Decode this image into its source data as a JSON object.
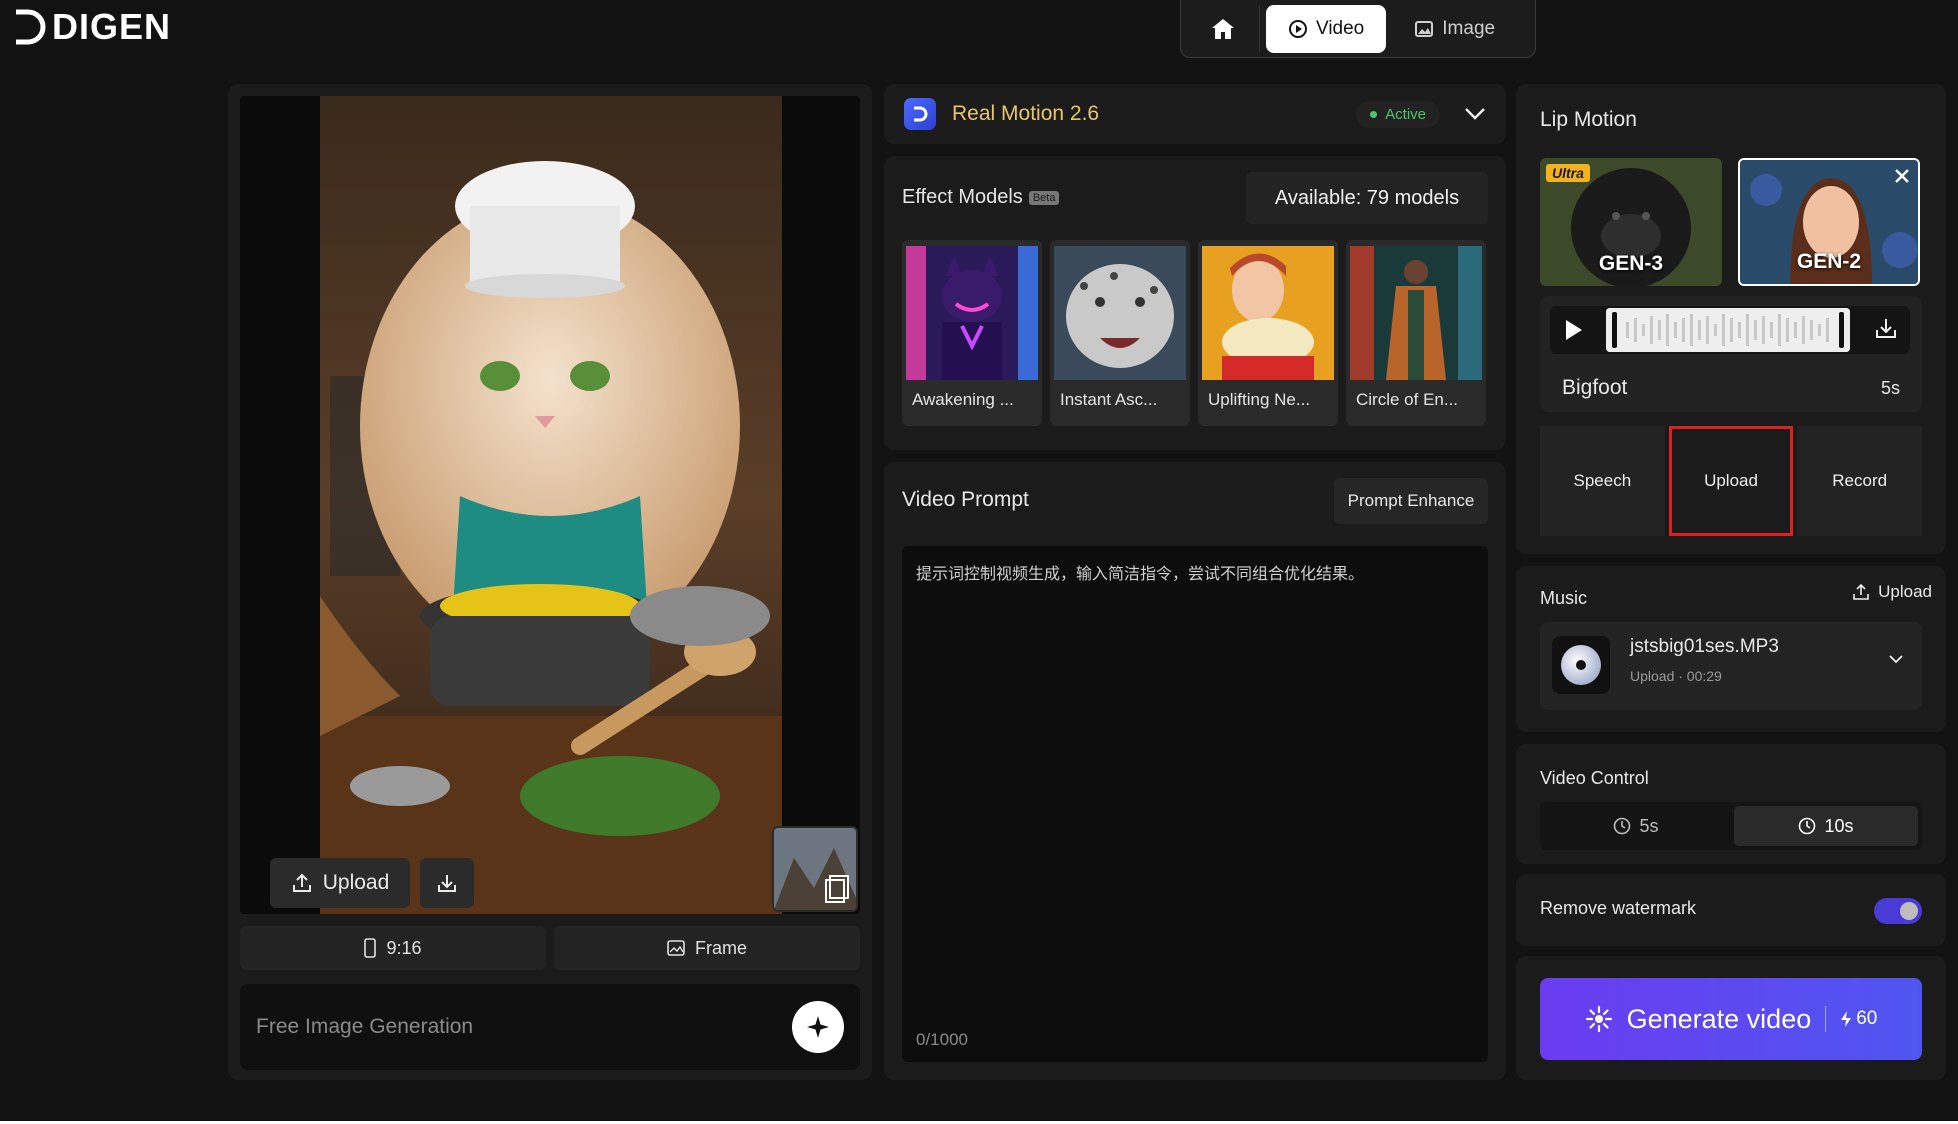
{
  "brand": {
    "name": "DIGEN"
  },
  "topnav": {
    "tabs": [
      {
        "label": "Video"
      },
      {
        "label": "Image"
      }
    ]
  },
  "left": {
    "upload_label": "Upload",
    "ratio_label": "9:16",
    "frame_label": "Frame",
    "free_gen_placeholder": "Free Image Generation"
  },
  "model": {
    "name": "Real Motion 2.6",
    "status": "Active"
  },
  "effects": {
    "title": "Effect Models",
    "badge": "Beta",
    "available": "Available: 79 models",
    "cards": [
      {
        "label": "Awakening ..."
      },
      {
        "label": "Instant Asc..."
      },
      {
        "label": "Uplifting Ne..."
      },
      {
        "label": "Circle of En..."
      }
    ]
  },
  "prompt": {
    "title": "Video Prompt",
    "enhance_label": "Prompt Enhance",
    "placeholder": "提示词控制视频生成，输入简洁指令，尝试不同组合优化结果。",
    "counter": "0/1000"
  },
  "lip": {
    "title": "Lip Motion",
    "gens": [
      {
        "label": "GEN-3",
        "badge": "Ultra"
      },
      {
        "label": "GEN-2"
      }
    ],
    "audio_name": "Bigfoot",
    "audio_len": "5s",
    "tabs": [
      {
        "label": "Speech"
      },
      {
        "label": "Upload"
      },
      {
        "label": "Record"
      }
    ]
  },
  "music": {
    "title": "Music",
    "upload_label": "Upload",
    "file_name": "jstsbig01ses.MP3",
    "file_sub": "Upload · 00:29"
  },
  "video_control": {
    "title": "Video Control",
    "options": [
      {
        "label": "5s"
      },
      {
        "label": "10s"
      }
    ],
    "selected": "10s"
  },
  "watermark": {
    "label": "Remove watermark",
    "enabled": true
  },
  "generate": {
    "label": "Generate video",
    "cost": "60"
  },
  "colors": {
    "accent": "#5b48f0",
    "gold": "#e9c56c",
    "active_green": "#4cc46a",
    "highlight": "#e02020"
  }
}
